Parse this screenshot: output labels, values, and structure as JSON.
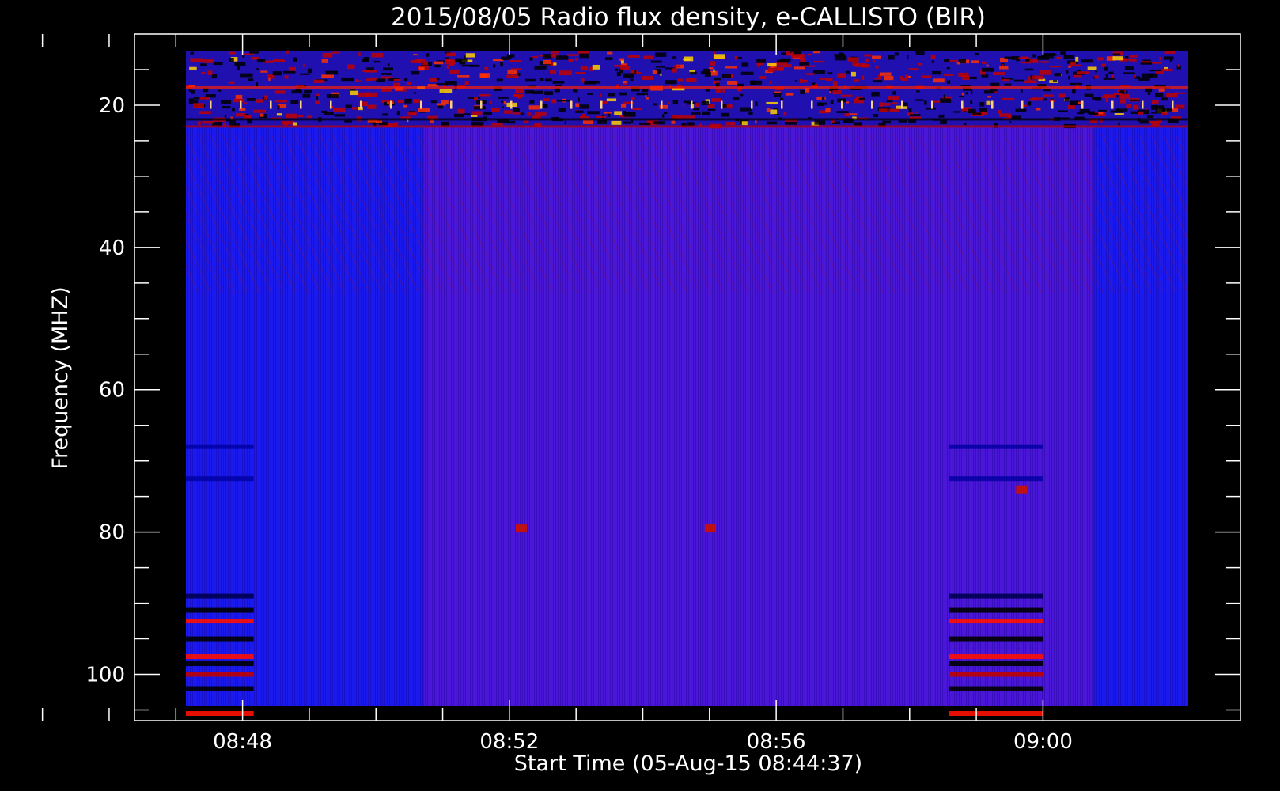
{
  "chart_data": {
    "type": "heatmap",
    "title": "2015/08/05  Radio flux density, e-CALLISTO (BIR)",
    "xlabel": "Start Time (05-Aug-15 08:44:37)",
    "ylabel": "Frequency (MHZ)",
    "x_start": "08:44:37",
    "x_end": "09:00:00",
    "xlim_minutes": [
      -0.62,
      15.96
    ],
    "x_ticks": [
      "08:48",
      "08:52",
      "08:56",
      "09:00"
    ],
    "ylim": [
      10,
      106.5
    ],
    "y_ticks": [
      20,
      40,
      60,
      80,
      100
    ],
    "y_inverted": true,
    "colormap": [
      "#000000",
      "#0000ff",
      "#ff0000",
      "#ffffff"
    ],
    "background": "#000000",
    "axis_color": "#ffffff",
    "features": [
      {
        "kind": "rfi-band",
        "freq_range": [
          10,
          23
        ],
        "description": "intense interference across full time range"
      },
      {
        "kind": "horizontal-lines",
        "freqs": [
          89,
          91,
          92.5,
          95,
          97.5,
          98.5,
          100,
          102,
          105.5
        ],
        "time_ranges": [
          [
            "08:44:37",
            "08:48:10"
          ],
          [
            "08:58:35",
            "09:00:00"
          ]
        ]
      },
      {
        "kind": "spot",
        "freq": 79.5,
        "time": "08:52:10"
      },
      {
        "kind": "spot",
        "freq": 79.5,
        "time": "08:55:00"
      },
      {
        "kind": "spot",
        "freq": 74,
        "time": "08:59:40"
      }
    ]
  }
}
